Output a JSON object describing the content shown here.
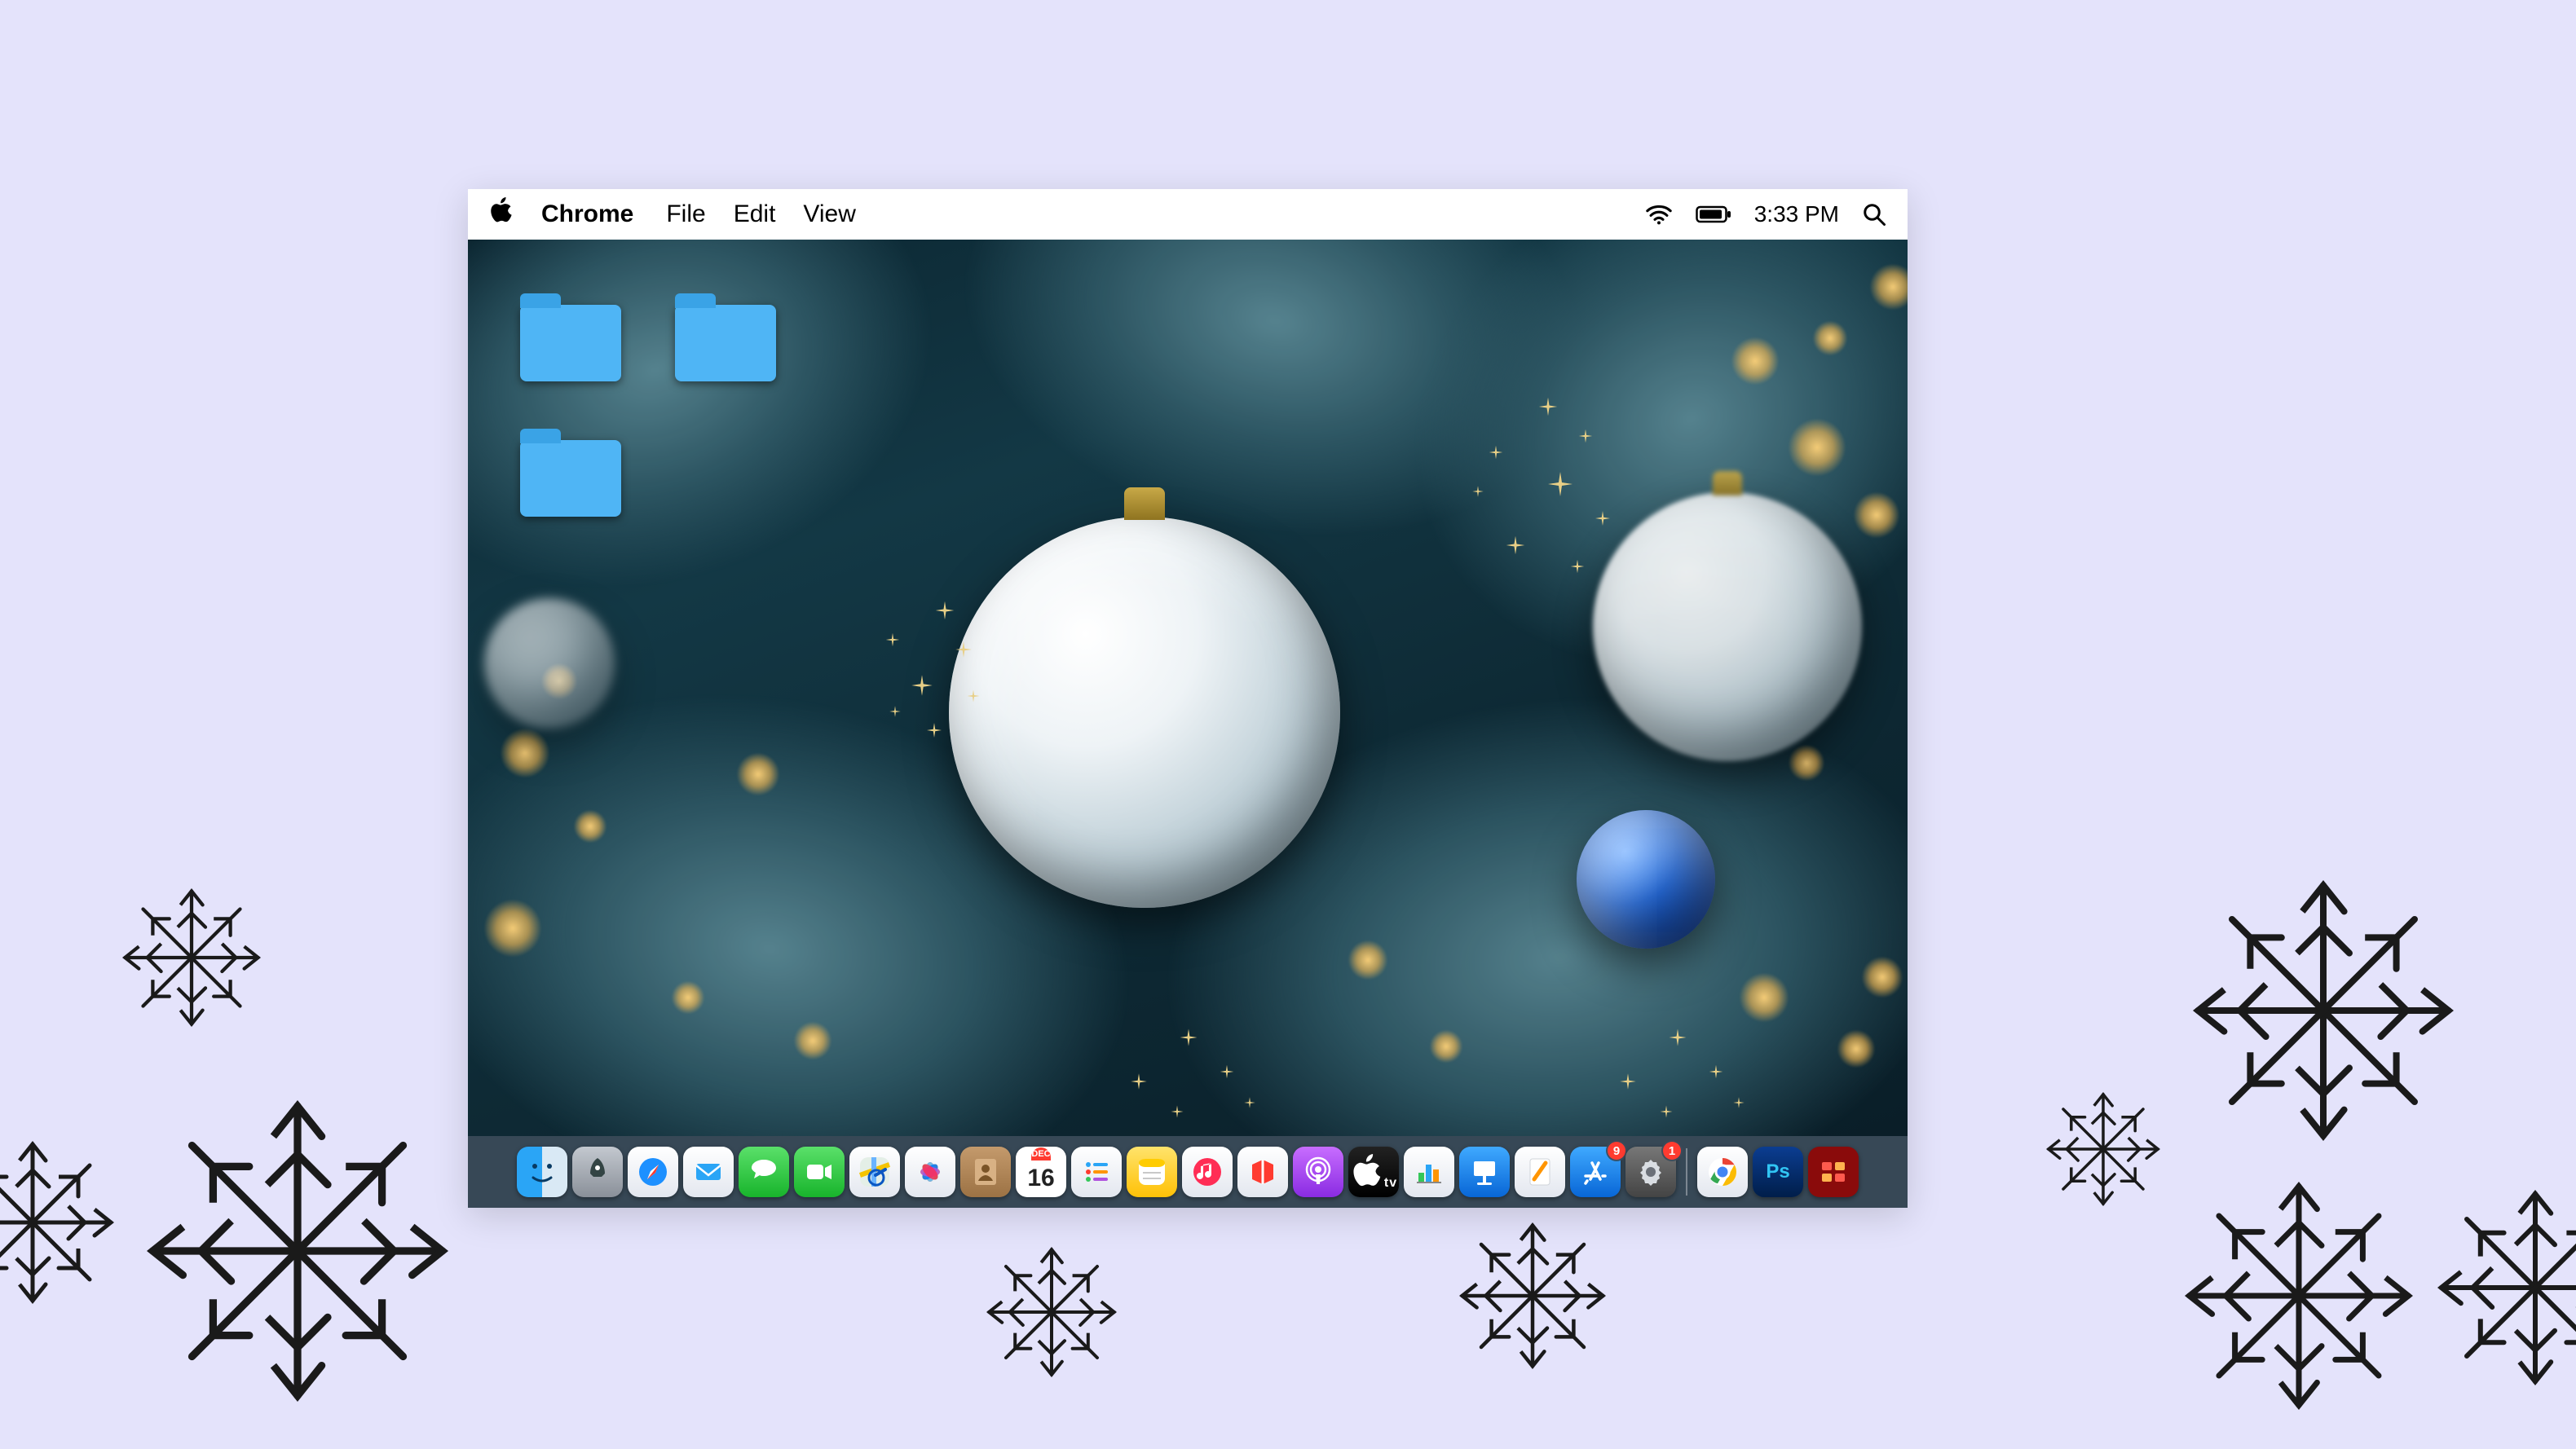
{
  "menubar": {
    "app_name": "Chrome",
    "items": [
      "File",
      "Edit",
      "View"
    ],
    "clock": "3:33 PM"
  },
  "desktop_folders": [
    {
      "id": "folder-1"
    },
    {
      "id": "folder-2"
    },
    {
      "id": "folder-3"
    }
  ],
  "calendar": {
    "month_label": "DEC",
    "day": "16"
  },
  "dock": {
    "items": [
      {
        "id": "finder",
        "name": "Finder",
        "icon": "finder-icon"
      },
      {
        "id": "launchpad",
        "name": "Launchpad",
        "icon": "rocket-icon"
      },
      {
        "id": "safari",
        "name": "Safari",
        "icon": "compass-icon"
      },
      {
        "id": "mail",
        "name": "Mail",
        "icon": "mail-icon"
      },
      {
        "id": "messages",
        "name": "Messages",
        "icon": "messages-icon"
      },
      {
        "id": "facetime",
        "name": "FaceTime",
        "icon": "video-icon"
      },
      {
        "id": "maps",
        "name": "Maps",
        "icon": "map-icon"
      },
      {
        "id": "photos",
        "name": "Photos",
        "icon": "flower-icon"
      },
      {
        "id": "contacts",
        "name": "Contacts",
        "icon": "book-icon"
      },
      {
        "id": "calendar",
        "name": "Calendar",
        "icon": "calendar-icon"
      },
      {
        "id": "reminders",
        "name": "Reminders",
        "icon": "list-icon"
      },
      {
        "id": "notes",
        "name": "Notes",
        "icon": "note-icon"
      },
      {
        "id": "music",
        "name": "Music",
        "icon": "music-icon"
      },
      {
        "id": "news",
        "name": "News",
        "icon": "news-icon"
      },
      {
        "id": "podcasts",
        "name": "Podcasts",
        "icon": "podcast-icon"
      },
      {
        "id": "tv",
        "name": "TV",
        "icon": "tv-icon"
      },
      {
        "id": "numbers",
        "name": "Numbers",
        "icon": "chart-icon"
      },
      {
        "id": "keynote",
        "name": "Keynote",
        "icon": "podium-icon"
      },
      {
        "id": "pages",
        "name": "Pages",
        "icon": "pen-icon"
      },
      {
        "id": "appstore",
        "name": "App Store",
        "icon": "appstore-icon",
        "badge": "9"
      },
      {
        "id": "settings",
        "name": "System Preferences",
        "icon": "gear-icon",
        "badge": "1"
      },
      {
        "id": "divider",
        "name": "divider"
      },
      {
        "id": "chrome",
        "name": "Google Chrome",
        "icon": "chrome-icon"
      },
      {
        "id": "photoshop",
        "name": "Photoshop",
        "icon": "ps-icon"
      },
      {
        "id": "tool",
        "name": "Utility",
        "icon": "tool-icon"
      }
    ]
  },
  "status": {
    "wifi_label": "Wi-Fi",
    "battery_label": "Battery",
    "search_label": "Spotlight"
  }
}
